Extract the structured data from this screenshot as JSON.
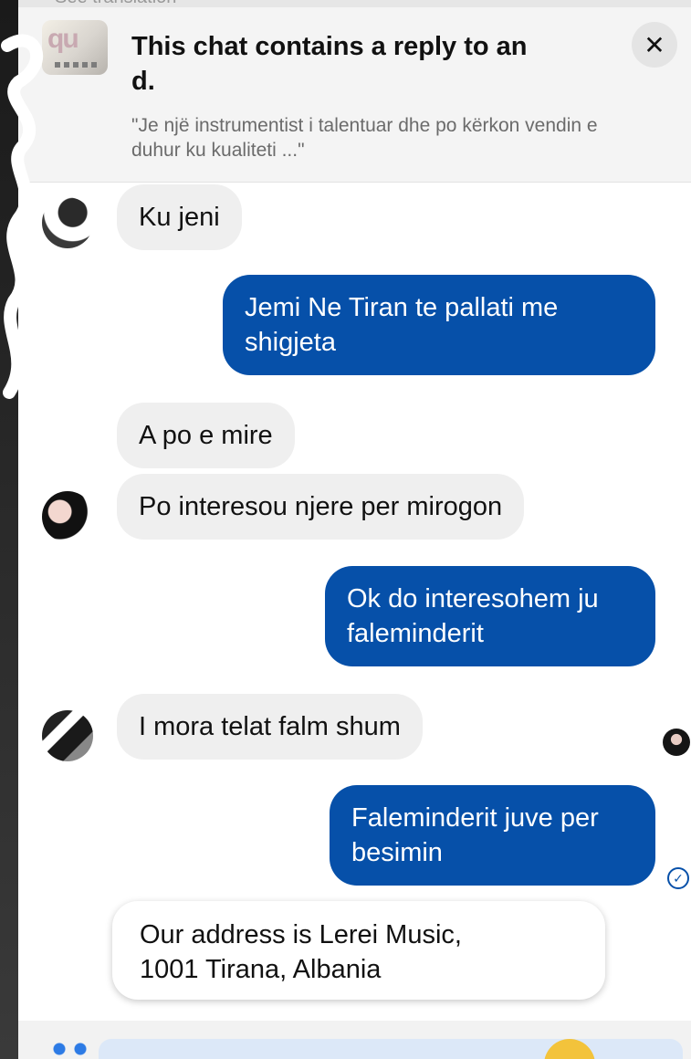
{
  "top_label": "See translation",
  "reply_notice": {
    "title": "This chat contains a reply to an\n  d.",
    "quote": "\"Je një instrumentist i talentuar dhe po kërkon vendin e duhur ku kualiteti ...\"",
    "close": "✕"
  },
  "messages": [
    {
      "side": "in",
      "text": "Ku jeni"
    },
    {
      "side": "out",
      "text": "Jemi Ne Tiran te pallati me\nshigjeta"
    },
    {
      "side": "in",
      "text": "A po e mire"
    },
    {
      "side": "in",
      "text": "Po interesou njere per mirogon"
    },
    {
      "side": "out",
      "text": "Ok do interesohem ju\nfaleminderit"
    },
    {
      "side": "in",
      "text": "I mora telat falm shum"
    },
    {
      "side": "out",
      "text": "Faleminderit juve per\nbesimin"
    }
  ],
  "address_card": {
    "text": "Our address is Lerei Music,\n1001 Tirana, Albania"
  },
  "seen_icon": "✓",
  "colors": {
    "outgoing_bubble": "#0650a9",
    "incoming_bubble": "#efefef",
    "header_bg": "#f4f4f4"
  }
}
